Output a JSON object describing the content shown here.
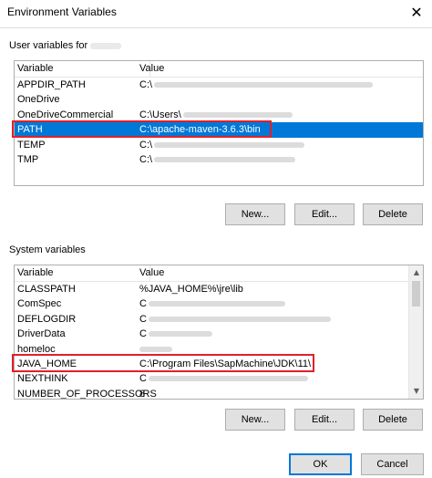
{
  "window": {
    "title": "Environment Variables"
  },
  "user_section": {
    "label": "User variables for",
    "columns": {
      "variable": "Variable",
      "value": "Value"
    },
    "rows": [
      {
        "variable": "APPDIR_PATH",
        "value": "C:\\"
      },
      {
        "variable": "OneDrive",
        "value": ""
      },
      {
        "variable": "OneDriveCommercial",
        "value": "C:\\Users\\"
      },
      {
        "variable": "PATH",
        "value": "C:\\apache-maven-3.6.3\\bin"
      },
      {
        "variable": "TEMP",
        "value": "C:\\"
      },
      {
        "variable": "TMP",
        "value": "C:\\"
      }
    ],
    "buttons": {
      "new": "New...",
      "edit": "Edit...",
      "delete": "Delete"
    }
  },
  "system_section": {
    "label": "System variables",
    "columns": {
      "variable": "Variable",
      "value": "Value"
    },
    "rows": [
      {
        "variable": "CLASSPATH",
        "value": "%JAVA_HOME%\\jre\\lib"
      },
      {
        "variable": "ComSpec",
        "value": "C"
      },
      {
        "variable": "DEFLOGDIR",
        "value": "C"
      },
      {
        "variable": "DriverData",
        "value": "C"
      },
      {
        "variable": "homeloc",
        "value": ""
      },
      {
        "variable": "JAVA_HOME",
        "value": "C:\\Program Files\\SapMachine\\JDK\\11\\"
      },
      {
        "variable": "NEXTHINK",
        "value": "C"
      },
      {
        "variable": "NUMBER_OF_PROCESSORS",
        "value": "8"
      }
    ],
    "buttons": {
      "new": "New...",
      "edit": "Edit...",
      "delete": "Delete"
    }
  },
  "footer": {
    "ok": "OK",
    "cancel": "Cancel"
  },
  "colors": {
    "selection": "#0078d7",
    "highlight": "#e0202a"
  }
}
